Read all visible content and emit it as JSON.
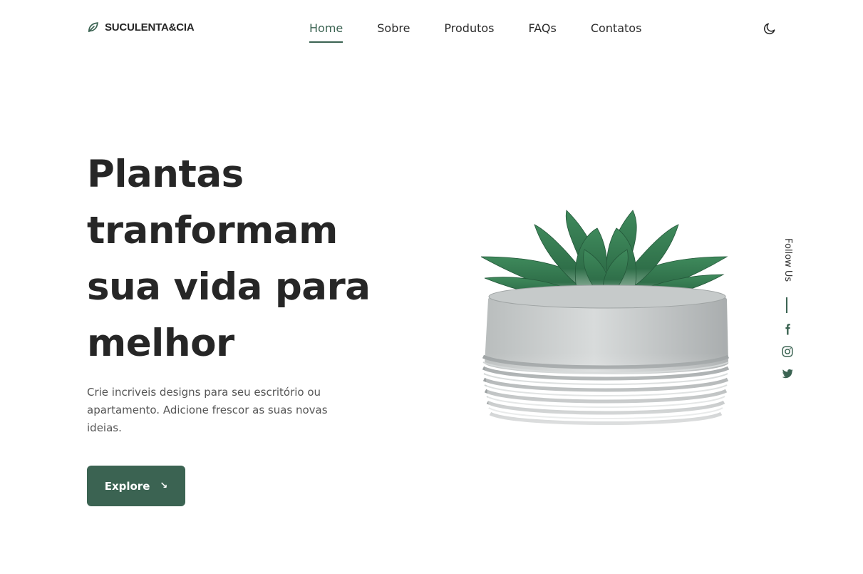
{
  "brand": {
    "name": "SUCULENTA&CIA",
    "icon": "leaf-icon"
  },
  "nav": {
    "items": [
      "Home",
      "Sobre",
      "Produtos",
      "FAQs",
      "Contatos"
    ],
    "active": "Home"
  },
  "theme_toggle": {
    "icon": "moon-icon"
  },
  "hero": {
    "title": "Plantas tranformam sua vida para melhor",
    "description": "Crie incriveis designs para seu escritório ou apartamento. Adicione frescor as suas novas ideias.",
    "button_label": "Explore",
    "button_icon": "arrow-down-right-icon"
  },
  "social": {
    "label": "Follow Us",
    "links": [
      "facebook-icon",
      "instagram-icon",
      "twitter-icon"
    ]
  },
  "colors": {
    "accent": "#3b6352",
    "text": "#262626",
    "muted": "#555555",
    "background": "#ffffff"
  }
}
